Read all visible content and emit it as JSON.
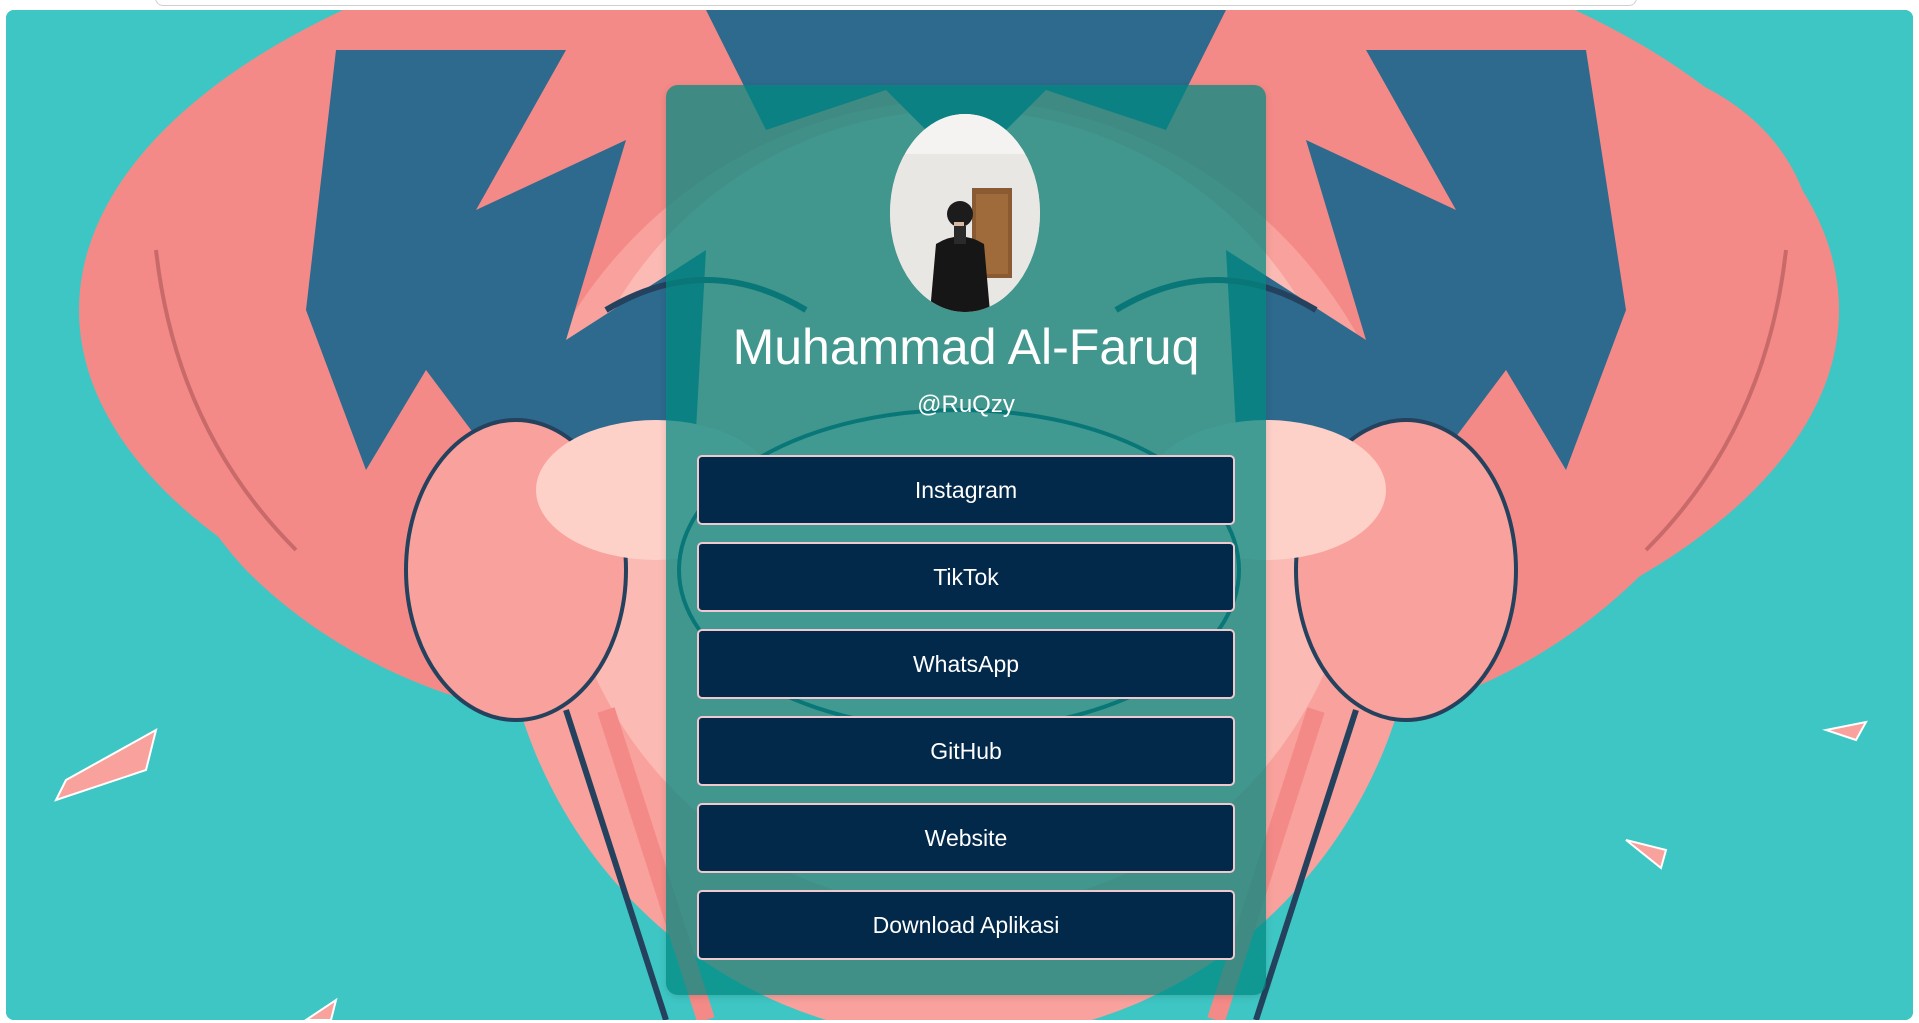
{
  "profile": {
    "name": "Muhammad Al-Faruq",
    "handle": "@RuQzy"
  },
  "links": [
    {
      "label": "Instagram"
    },
    {
      "label": "TikTok"
    },
    {
      "label": "WhatsApp"
    },
    {
      "label": "GitHub"
    },
    {
      "label": "Website"
    },
    {
      "label": "Download Aplikasi"
    }
  ],
  "colors": {
    "background": "#3ec6c4",
    "card": "#008980",
    "button": "#02284a",
    "button_border": "#f0c8cf",
    "text": "#ffffff"
  }
}
